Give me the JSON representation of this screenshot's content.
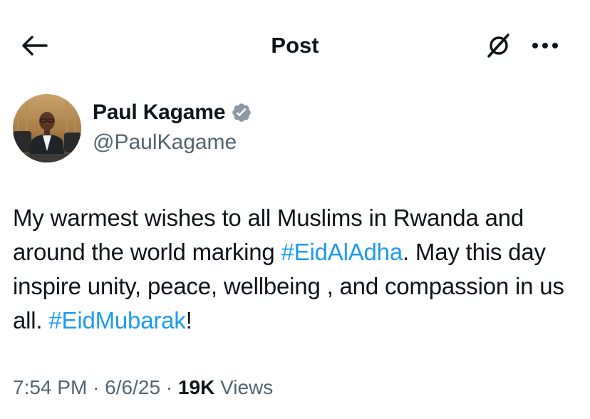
{
  "header": {
    "title": "Post",
    "back_icon": "arrow-left-icon",
    "grok_icon": "grok-slash-icon",
    "more_icon": "more-horizontal-icon"
  },
  "author": {
    "name": "Paul Kagame",
    "handle": "@PaulKagame",
    "verified": true,
    "verified_color": "#8b98a5"
  },
  "tweet": {
    "segments": [
      {
        "text": "My warmest wishes to all Muslims in Rwanda and around the world marking ",
        "hashtag": false
      },
      {
        "text": "#EidAlAdha",
        "hashtag": true
      },
      {
        "text": ". May this day inspire unity, peace, wellbeing , and compassion in us all. ",
        "hashtag": false
      },
      {
        "text": "#EidMubarak",
        "hashtag": true
      },
      {
        "text": "!",
        "hashtag": false
      }
    ],
    "hashtag_color": "#1d9bf0"
  },
  "meta": {
    "time": "7:54 PM",
    "separator": "·",
    "date": "6/6/25",
    "views_count": "19K",
    "views_label": "Views"
  }
}
